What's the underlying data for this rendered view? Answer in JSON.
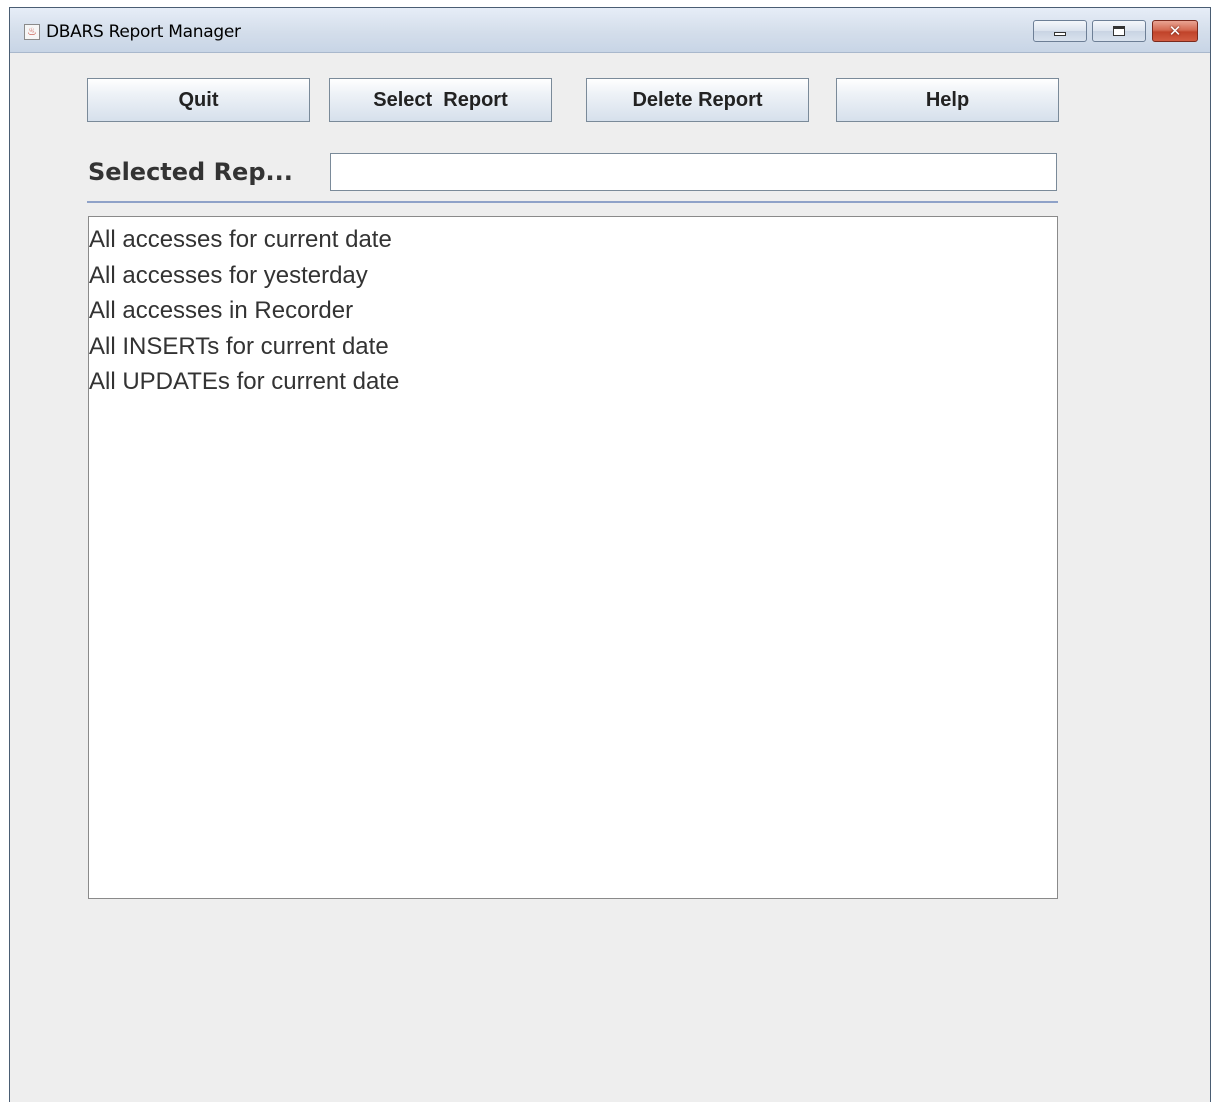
{
  "window": {
    "title": "DBARS Report Manager",
    "icon": "java-app-icon"
  },
  "toolbar": {
    "quit_label": "Quit",
    "select_label": "Select  Report",
    "delete_label": "Delete Report",
    "help_label": "Help"
  },
  "selected": {
    "label": "Selected Rep...",
    "value": ""
  },
  "reports": [
    "All accesses for current date",
    "All accesses for yesterday",
    "All accesses in Recorder",
    "All INSERTs for current date",
    "All UPDATEs for current date"
  ]
}
